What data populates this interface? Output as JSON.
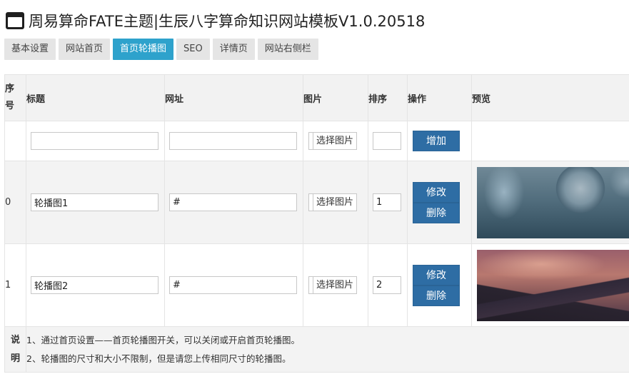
{
  "page": {
    "title": "周易算命FATE主题|生辰八字算命知识网站模板V1.0.20518"
  },
  "tabs": [
    {
      "label": "基本设置",
      "active": false
    },
    {
      "label": "网站首页",
      "active": false
    },
    {
      "label": "首页轮播图",
      "active": true
    },
    {
      "label": "SEO",
      "active": false
    },
    {
      "label": "详情页",
      "active": false
    },
    {
      "label": "网站右侧栏",
      "active": false
    }
  ],
  "table": {
    "headers": {
      "seq_a": "序",
      "seq_b": "号",
      "title": "标题",
      "url": "网址",
      "image": "图片",
      "sort": "排序",
      "action": "操作",
      "preview": "预览"
    },
    "add_row": {
      "title_value": "",
      "url_value": "",
      "pick_label": "选择图片",
      "sort_value": "",
      "add_label": "增加"
    },
    "rows": [
      {
        "seq": "0",
        "title_value": "轮播图1",
        "url_value": "#",
        "pick_label": "选择图片",
        "sort_value": "1",
        "edit_label": "修改",
        "delete_label": "删除"
      },
      {
        "seq": "1",
        "title_value": "轮播图2",
        "url_value": "#",
        "pick_label": "选择图片",
        "sort_value": "2",
        "edit_label": "修改",
        "delete_label": "删除"
      }
    ],
    "note": {
      "label_a": "说",
      "label_b": "明",
      "line1": "1、通过首页设置——首页轮播图开关，可以关闭或开启首页轮播图。",
      "line2": "2、轮播图的尺寸和大小不限制，但是请您上传相同尺寸的轮播图。"
    }
  },
  "colors": {
    "active_tab": "#2ea2cc",
    "primary_button": "#2e6da4",
    "tab_bg": "#e5e5e5"
  },
  "icons": {
    "app": "browser-window-icon"
  }
}
